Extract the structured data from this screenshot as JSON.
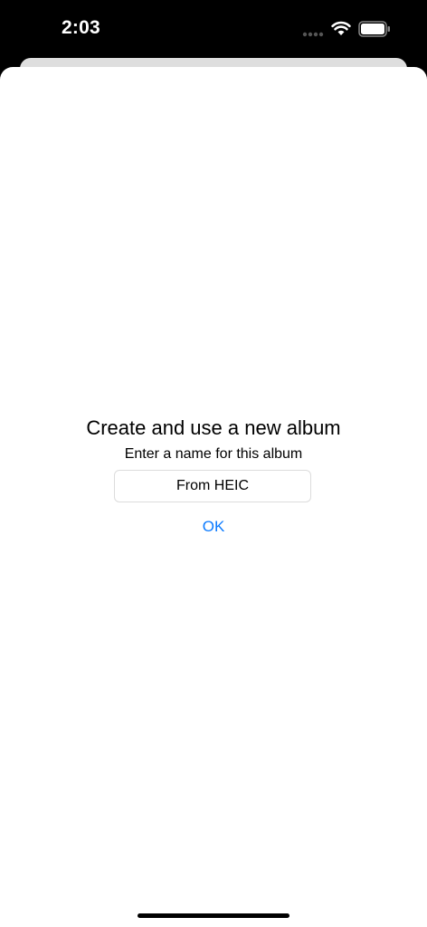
{
  "status_bar": {
    "time": "2:03",
    "icons": [
      "signal-dots-icon",
      "wifi-icon",
      "battery-icon"
    ]
  },
  "dialog": {
    "title": "Create and use a new album",
    "subtitle": "Enter a name for this album",
    "album_name_value": "From HEIC",
    "ok_label": "OK"
  },
  "colors": {
    "accent": "#0a7aff",
    "background": "#ffffff",
    "status_bar_bg": "#000000"
  }
}
